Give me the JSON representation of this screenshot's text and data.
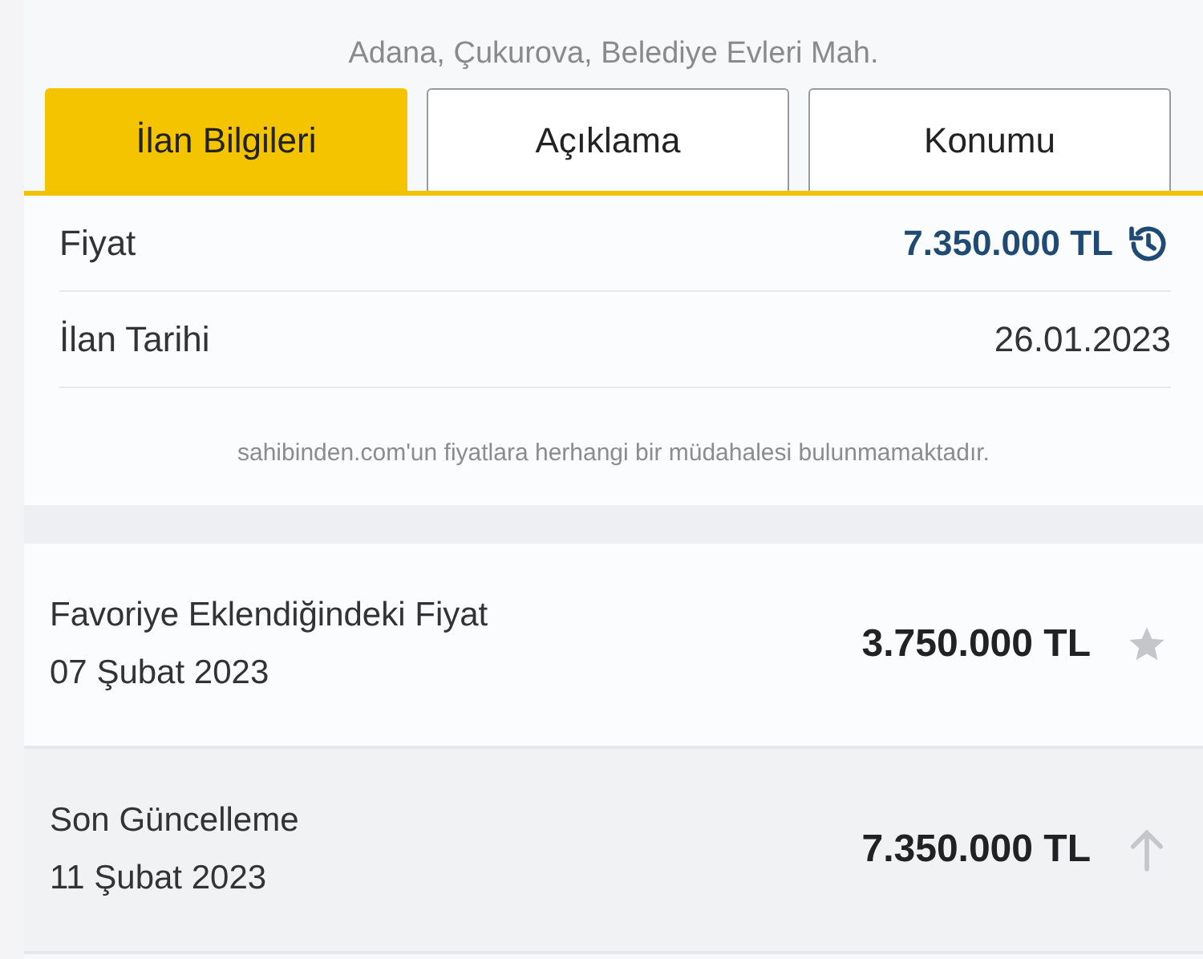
{
  "location": "Adana, Çukurova, Belediye Evleri Mah.",
  "tabs": [
    {
      "label": "İlan Bilgileri",
      "selected": true
    },
    {
      "label": "Açıklama",
      "selected": false
    },
    {
      "label": "Konumu",
      "selected": false
    }
  ],
  "details": [
    {
      "label": "Fiyat",
      "value": "7.350.000 TL",
      "kind": "price"
    },
    {
      "label": "İlan Tarihi",
      "value": "26.01.2023",
      "kind": "plain"
    }
  ],
  "disclaimer": "sahibinden.com'un fiyatlara herhangi bir müdahalesi bulunmamaktadır.",
  "price_history": [
    {
      "title": "Favoriye Eklendiğindeki Fiyat",
      "date": "07 Şubat 2023",
      "price": "3.750.000 TL",
      "kind": "favorite"
    },
    {
      "title": "Son Güncelleme",
      "date": "11 Şubat 2023",
      "price": "7.350.000 TL",
      "kind": "update"
    }
  ]
}
